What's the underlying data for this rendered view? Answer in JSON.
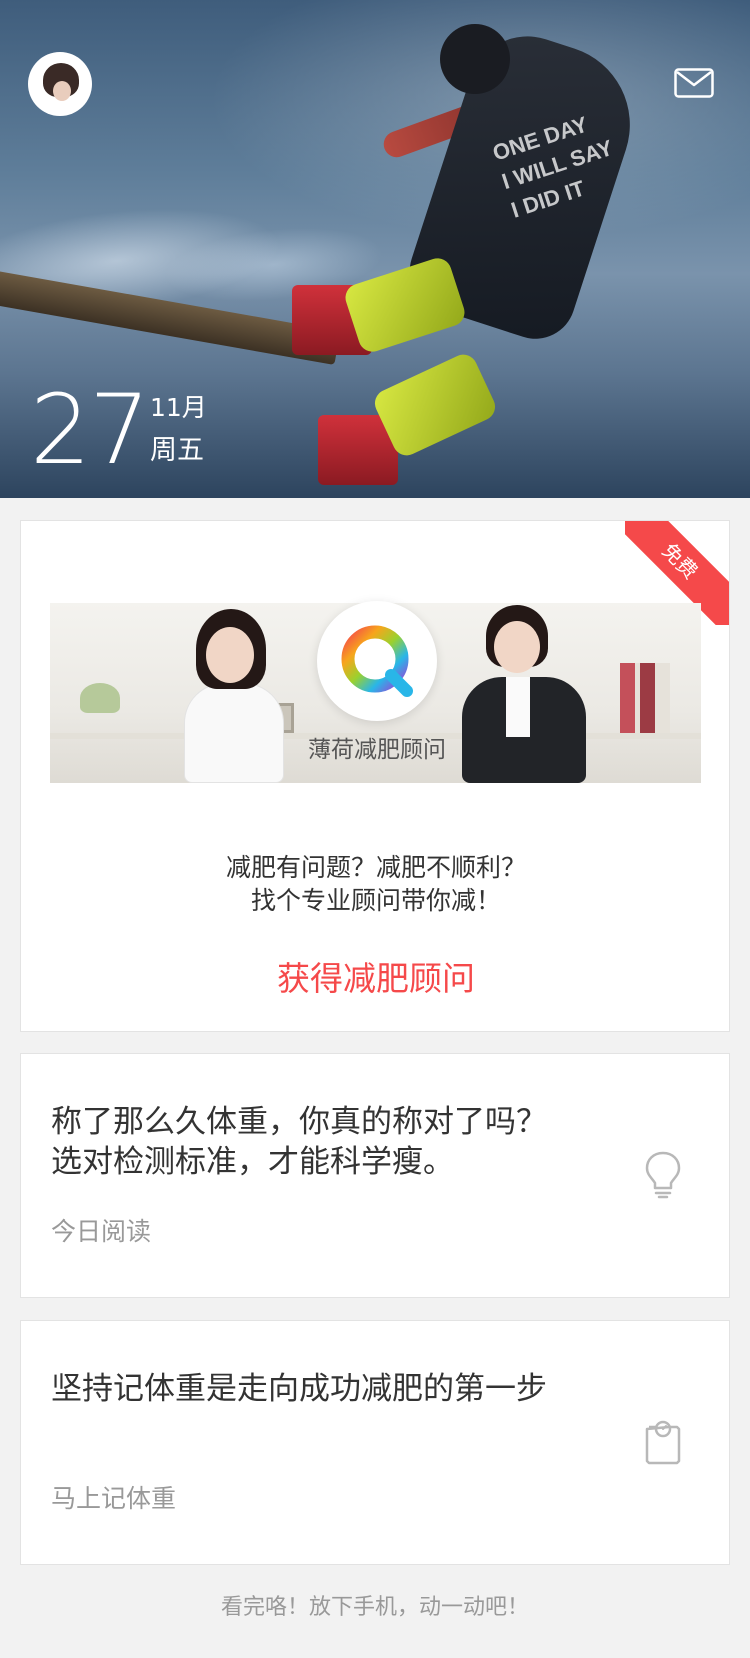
{
  "header": {
    "avatar_icon": "user-avatar",
    "mail_icon": "mail-icon",
    "shirt_text": "ONE DAY\nI WILL SAY\nI DID IT"
  },
  "date": {
    "day": "27",
    "month": "11月",
    "weekday": "周五"
  },
  "advisor_card": {
    "badge": "免费",
    "logo_caption": "薄荷减肥顾问",
    "description_line1": "减肥有问题？减肥不顺利？",
    "description_line2": "找个专业顾问带你减！",
    "cta": "获得减肥顾问",
    "accent_color": "#f5494a"
  },
  "article_card": {
    "title": "称了那么久体重，你真的称对了吗？选对检测标准，才能科学瘦。",
    "subtitle": "今日阅读",
    "icon": "lightbulb-icon"
  },
  "weight_card": {
    "title": "坚持记体重是走向成功减肥的第一步",
    "subtitle": "马上记体重",
    "icon": "scale-icon"
  },
  "footer": {
    "note": "看完咯！放下手机，动一动吧！"
  }
}
